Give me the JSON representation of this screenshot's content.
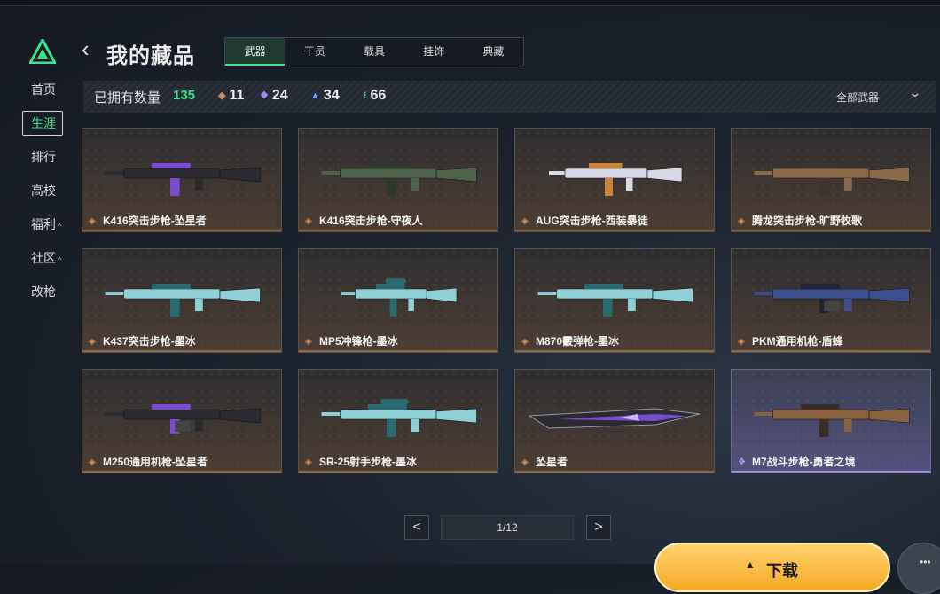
{
  "sidebar": {
    "items": [
      {
        "label": "首页",
        "caret": false,
        "active": false
      },
      {
        "label": "生涯",
        "caret": false,
        "active": true
      },
      {
        "label": "排行",
        "caret": false,
        "active": false
      },
      {
        "label": "高校",
        "caret": false,
        "active": false
      },
      {
        "label": "福利",
        "caret": true,
        "active": false
      },
      {
        "label": "社区",
        "caret": true,
        "active": false
      },
      {
        "label": "改枪",
        "caret": false,
        "active": false
      }
    ],
    "caret_glyph": "^"
  },
  "header": {
    "title": "我的藏品",
    "tabs": [
      "武器",
      "干员",
      "载具",
      "挂饰",
      "典藏"
    ],
    "active_tab": 0
  },
  "stats": {
    "owned_label": "已拥有数量",
    "owned_count": "135",
    "by_rarity": [
      {
        "icon": "orange-diamond-icon",
        "color": "#e0945a",
        "value": "11"
      },
      {
        "icon": "purple-diamond-icon",
        "color": "#a88cff",
        "value": "24"
      },
      {
        "icon": "blue-chevron-icon",
        "color": "#6aa6ff",
        "value": "34"
      },
      {
        "icon": "green-dots-icon",
        "color": "#3fe28a",
        "value": "66"
      }
    ],
    "filter_label": "全部武器"
  },
  "items": [
    {
      "name": "K416突击步枪-坠星者",
      "rarity": "orange",
      "kind": "rifle",
      "color": "#2a2a30",
      "accent": "#7b4bd1"
    },
    {
      "name": "K416突击步枪-守夜人",
      "rarity": "orange",
      "kind": "rifle",
      "color": "#4d6248",
      "accent": "#2d3a2b"
    },
    {
      "name": "AUG突击步枪-西装暴徒",
      "rarity": "orange",
      "kind": "bullpup",
      "color": "#d7d9e6",
      "accent": "#c9853b"
    },
    {
      "name": "腾龙突击步枪-旷野牧歌",
      "rarity": "orange",
      "kind": "rifle",
      "color": "#8a6a48",
      "accent": "#3a3530"
    },
    {
      "name": "K437突击步枪-墨冰",
      "rarity": "orange",
      "kind": "rifle",
      "color": "#8fd0d6",
      "accent": "#2a6b72"
    },
    {
      "name": "MP5冲锋枪-墨冰",
      "rarity": "orange",
      "kind": "smg",
      "color": "#8fd0d6",
      "accent": "#2a6b72"
    },
    {
      "name": "M870霰弹枪-墨冰",
      "rarity": "orange",
      "kind": "shotgun",
      "color": "#8fd0d6",
      "accent": "#2a6b72"
    },
    {
      "name": "PKM通用机枪-盾蜂",
      "rarity": "orange",
      "kind": "mg",
      "color": "#3c4f8c",
      "accent": "#1f2433"
    },
    {
      "name": "M250通用机枪-坠星者",
      "rarity": "orange",
      "kind": "mg",
      "color": "#2a2a30",
      "accent": "#7b4bd1"
    },
    {
      "name": "SR-25射手步枪-墨冰",
      "rarity": "orange",
      "kind": "sniper",
      "color": "#8fd0d6",
      "accent": "#2a6b72"
    },
    {
      "name": "坠星者",
      "rarity": "orange",
      "kind": "knife",
      "color": "#2a2a30",
      "accent": "#7b4bd1"
    },
    {
      "name": "M7战斗步枪-勇者之境",
      "rarity": "purple",
      "kind": "rifle",
      "color": "#8a6240",
      "accent": "#3a2e24"
    }
  ],
  "pagination": {
    "prev_glyph": "<",
    "next_glyph": ">",
    "display": "1/12"
  },
  "bottom_button": {
    "label": "下载",
    "icon": "triangle-icon"
  }
}
